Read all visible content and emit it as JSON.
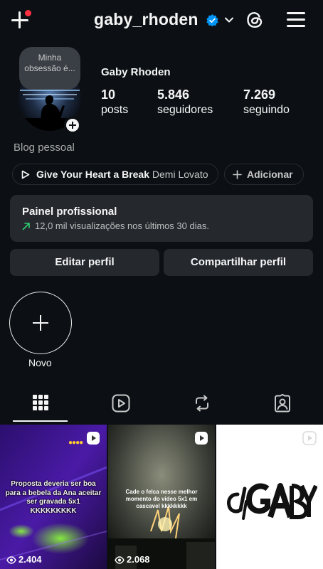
{
  "header": {
    "username": "gaby_rhoden",
    "new_post_icon": "plus-icon",
    "has_notification": true,
    "verified_icon": "verified-badge-icon",
    "switch_icon": "chevron-down-icon",
    "threads_icon": "threads-icon",
    "menu_icon": "hamburger-menu-icon"
  },
  "profile": {
    "note": "Minha obsessão é...",
    "display_name": "Gaby Rhoden",
    "category": "Blog pessoal",
    "stats": [
      {
        "value": "10",
        "label": "posts"
      },
      {
        "value": "5.846",
        "label": "seguidores"
      },
      {
        "value": "7.269",
        "label": "seguindo"
      }
    ]
  },
  "music": {
    "song": "Give Your Heart a Break",
    "artist": "Demi Lovato",
    "add_label": "Adicionar"
  },
  "dashboard": {
    "title": "Painel profissional",
    "subtitle": "12,0 mil visualizações nos últimos 30 dias.",
    "trend_color": "#2ecc71"
  },
  "actions": {
    "edit": "Editar perfil",
    "share": "Compartilhar perfil"
  },
  "highlights": {
    "new_label": "Novo"
  },
  "tabs": [
    {
      "name": "grid",
      "icon": "grid-icon",
      "active": true
    },
    {
      "name": "reels",
      "icon": "reels-icon",
      "active": false
    },
    {
      "name": "reposts",
      "icon": "repost-icon",
      "active": false
    },
    {
      "name": "tagged",
      "icon": "tagged-user-icon",
      "active": false
    }
  ],
  "posts": [
    {
      "caption": "Proposta deveria ser boa para a bebela da Ana aceitar ser gravada 5x1 KKKKKKKKK",
      "views": "2.404"
    },
    {
      "caption": "Cade o felca nesse melhor momento do video 5x1 em cascavel kkkkkkkk",
      "views": "2.068"
    },
    {
      "logo_text": "djGABY",
      "views": ""
    }
  ],
  "colors": {
    "background": "#0c1014",
    "surface": "#25292e",
    "verified": "#0095f6",
    "notification": "#ff3040"
  }
}
